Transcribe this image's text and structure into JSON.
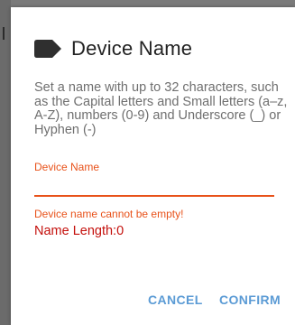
{
  "dialog": {
    "title": "Device Name",
    "title_icon": "tag-icon",
    "description": "Set a name with up to 32 characters, such as the Capital letters and Small letters (a–z, A-Z), numbers (0-9) and Underscore (_) or Hyphen (-)",
    "field": {
      "label": "Device Name",
      "value": "",
      "placeholder": ""
    },
    "error": "Device name cannot be empty!",
    "name_length": "Name Length:0",
    "buttons": {
      "cancel": "CANCEL",
      "confirm": "CONFIRM"
    }
  },
  "colors": {
    "accent": "#e8521a",
    "error_red": "#c4100c",
    "button_blue": "#5b9bd5",
    "title_text": "#222222",
    "body_text": "#6f6f6f"
  }
}
